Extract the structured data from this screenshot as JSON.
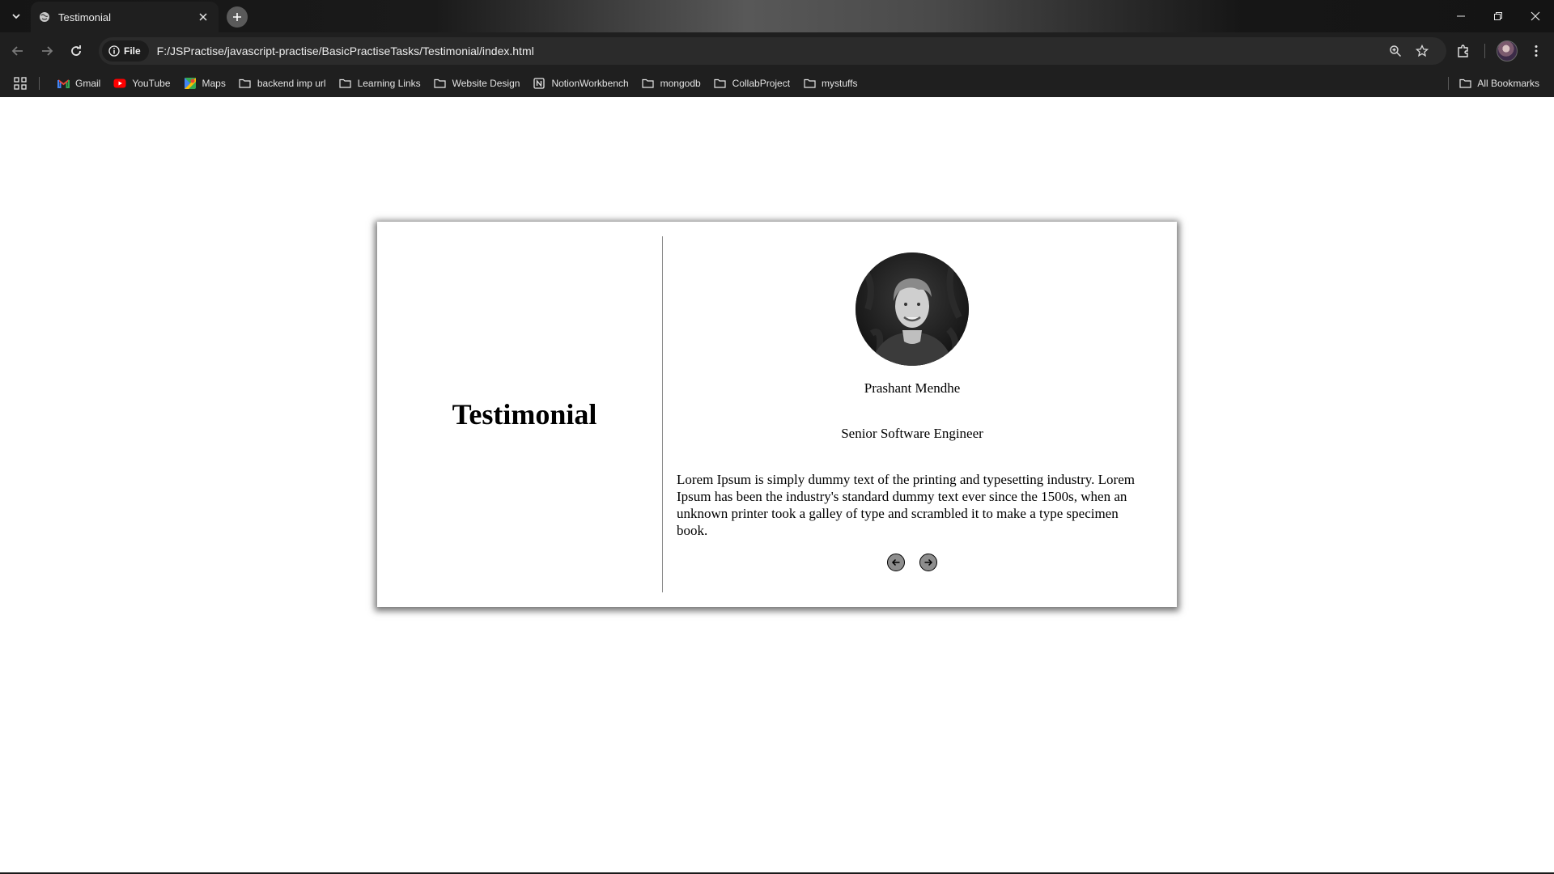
{
  "browser": {
    "tab": {
      "title": "Testimonial"
    },
    "address": {
      "chip_label": "File",
      "url": "F:/JSPractise/javascript-practise/BasicPractiseTasks/Testimonial/index.html"
    },
    "icons": {
      "tab_list": "chevron-down-icon",
      "favicon": "globe-icon",
      "new_tab": "plus-icon",
      "back": "arrow-left-icon",
      "forward": "arrow-right-icon",
      "reload": "reload-icon",
      "site_info": "info-icon",
      "zoom": "zoom-icon",
      "bookmark": "star-icon",
      "extensions": "puzzle-icon",
      "menu": "kebab-menu-icon",
      "minimize": "minimize-icon",
      "restore": "restore-icon",
      "close": "close-icon"
    }
  },
  "bookmarks": {
    "items": [
      {
        "label": "Gmail",
        "icon": "gmail-icon"
      },
      {
        "label": "YouTube",
        "icon": "youtube-icon"
      },
      {
        "label": "Maps",
        "icon": "maps-icon"
      },
      {
        "label": "backend imp url",
        "icon": "folder-icon"
      },
      {
        "label": "Learning Links",
        "icon": "folder-icon"
      },
      {
        "label": "Website Design",
        "icon": "folder-icon"
      },
      {
        "label": "NotionWorkbench",
        "icon": "notion-icon"
      },
      {
        "label": "mongodb",
        "icon": "folder-icon"
      },
      {
        "label": "CollabProject",
        "icon": "folder-icon"
      },
      {
        "label": "mystuffs",
        "icon": "folder-icon"
      }
    ],
    "all_label": "All Bookmarks"
  },
  "page": {
    "heading": "Testimonial",
    "testimonial": {
      "name": "Prashant Mendhe",
      "role": "Senior Software Engineer",
      "quote": "Lorem Ipsum is simply dummy text of the printing and typesetting industry. Lorem Ipsum has been the industry's standard dummy text ever since the 1500s, when an unknown printer took a galley of type and scrambled it to make a type specimen book."
    }
  },
  "colors": {
    "chrome_bg": "#1f1f1f",
    "card_bg": "#ffffff",
    "arrow_button": "#8e8e8e"
  }
}
